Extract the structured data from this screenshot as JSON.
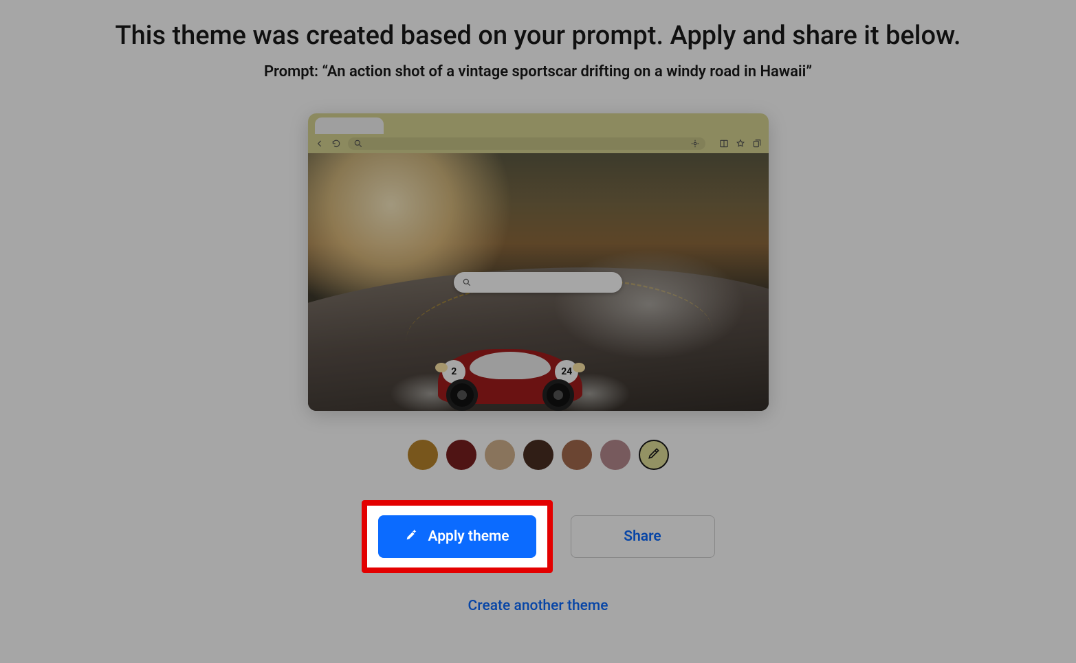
{
  "title": "This theme was created based on your prompt. Apply and share it below.",
  "prompt_label": "Prompt: ",
  "prompt_text": "“An action shot of a vintage sportscar drifting on a windy road in Hawaii”",
  "preview": {
    "car_number_left": "2",
    "car_number_right": "24"
  },
  "swatches": [
    {
      "name": "ochre",
      "color": "#b9852b"
    },
    {
      "name": "maroon",
      "color": "#7a1f1f"
    },
    {
      "name": "tan",
      "color": "#d3b38e"
    },
    {
      "name": "dark-brown",
      "color": "#4a2e22"
    },
    {
      "name": "copper",
      "color": "#a56b4e"
    },
    {
      "name": "mauve",
      "color": "#b78a90"
    }
  ],
  "picker_icon": "eyedropper-icon",
  "buttons": {
    "apply": "Apply theme",
    "share": "Share"
  },
  "create_link": "Create another theme"
}
